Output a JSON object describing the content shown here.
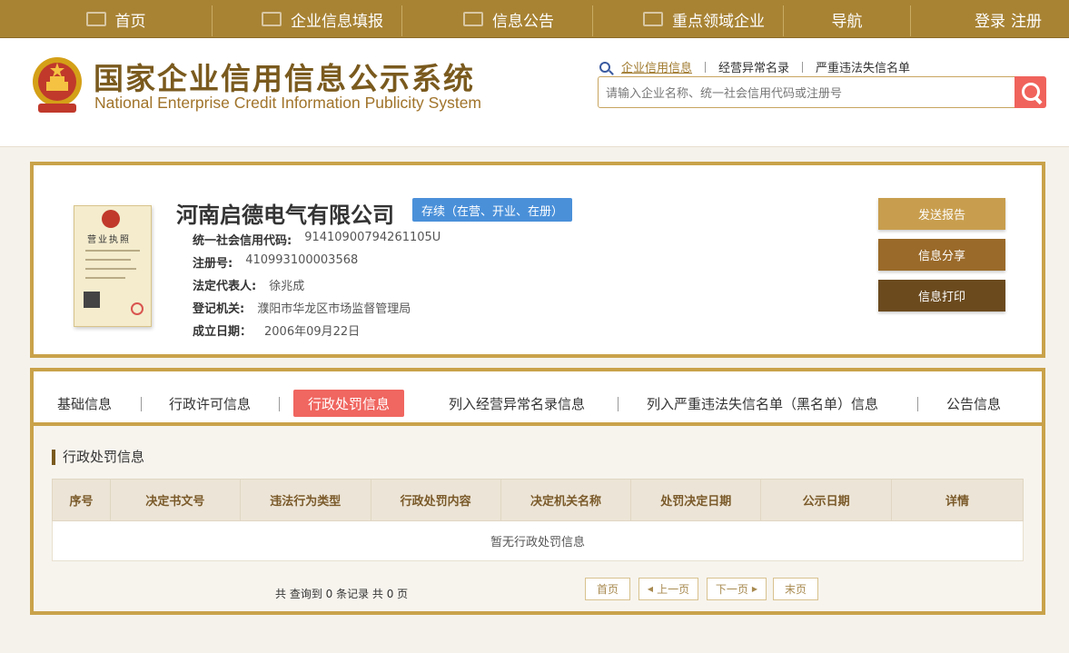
{
  "topnav": {
    "items": [
      {
        "label": "首页",
        "icon": "monitor-icon"
      },
      {
        "label": "企业信息填报",
        "icon": "edit-icon"
      },
      {
        "label": "信息公告",
        "icon": "document-icon"
      },
      {
        "label": "重点领域企业",
        "icon": "speaker-icon"
      },
      {
        "label": "导航",
        "icon": ""
      }
    ],
    "login": "登录",
    "register": "注册"
  },
  "header": {
    "title": "国家企业信用信息公示系统",
    "subtitle": "National Enterprise Credit Information Publicity System",
    "search_tabs": [
      "企业信用信息",
      "经营异常名录",
      "严重违法失信名单"
    ],
    "search_placeholder": "请输入企业名称、统一社会信用代码或注册号"
  },
  "company": {
    "name": "河南启德电气有限公司",
    "status": "存续（在营、开业、在册）",
    "license_title": "营业执照",
    "fields": [
      {
        "label": "统一社会信用代码:",
        "value": "91410900794261105U"
      },
      {
        "label": "注册号:",
        "value": "410993100003568"
      },
      {
        "label": "法定代表人:",
        "value": "徐兆成"
      },
      {
        "label": "登记机关:",
        "value": "濮阳市华龙区市场监督管理局"
      },
      {
        "label": "成立日期：",
        "value": "2006年09月22日"
      }
    ],
    "buttons": [
      "发送报告",
      "信息分享",
      "信息打印"
    ]
  },
  "tabs": {
    "items": [
      "基础信息",
      "行政许可信息",
      "行政处罚信息",
      "列入经营异常名录信息",
      "列入严重违法失信名单（黑名单）信息",
      "公告信息"
    ],
    "active": "行政处罚信息"
  },
  "penalty": {
    "section_title": "行政处罚信息",
    "columns": [
      "序号",
      "决定书文号",
      "违法行为类型",
      "行政处罚内容",
      "决定机关名称",
      "处罚决定日期",
      "公示日期",
      "详情"
    ],
    "empty_text": "暂无行政处罚信息",
    "pager_info": "共 查询到 0 条记录 共 0 页",
    "pager": {
      "first": "首页",
      "prev": "上一页",
      "next": "下一页",
      "last": "末页"
    }
  },
  "colors": {
    "gold": "#c9a24a",
    "nav": "#a88334",
    "badge": "#4a90d9",
    "active_tab": "#f06660",
    "btn_send": "#c89e4e",
    "btn_share": "#9a6a2a",
    "btn_print": "#6b4a1e"
  }
}
